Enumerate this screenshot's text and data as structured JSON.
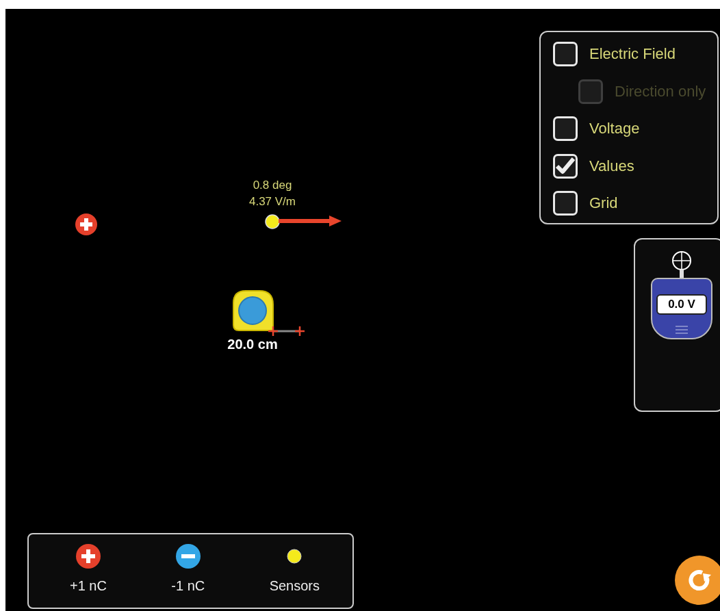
{
  "controls": [
    {
      "label": "Electric Field",
      "checked": false,
      "disabled": false,
      "kind": "main"
    },
    {
      "label": "Direction only",
      "checked": false,
      "disabled": true,
      "kind": "sub"
    },
    {
      "label": "Voltage",
      "checked": false,
      "disabled": false,
      "kind": "main"
    },
    {
      "label": "Values",
      "checked": true,
      "disabled": false,
      "kind": "main"
    },
    {
      "label": "Grid",
      "checked": false,
      "disabled": false,
      "kind": "main"
    }
  ],
  "charges": [
    {
      "kind": "positive"
    }
  ],
  "sensor": {
    "angle": "0.8 deg",
    "field": "4.37 V/m"
  },
  "tape": {
    "reading": "20.0 cm"
  },
  "voltmeter": {
    "reading": "0.0 V"
  },
  "toolbox": [
    {
      "label": "+1 nC",
      "kind": "positive"
    },
    {
      "label": "-1 nC",
      "kind": "negative"
    },
    {
      "label": "Sensors",
      "kind": "sensor"
    }
  ]
}
